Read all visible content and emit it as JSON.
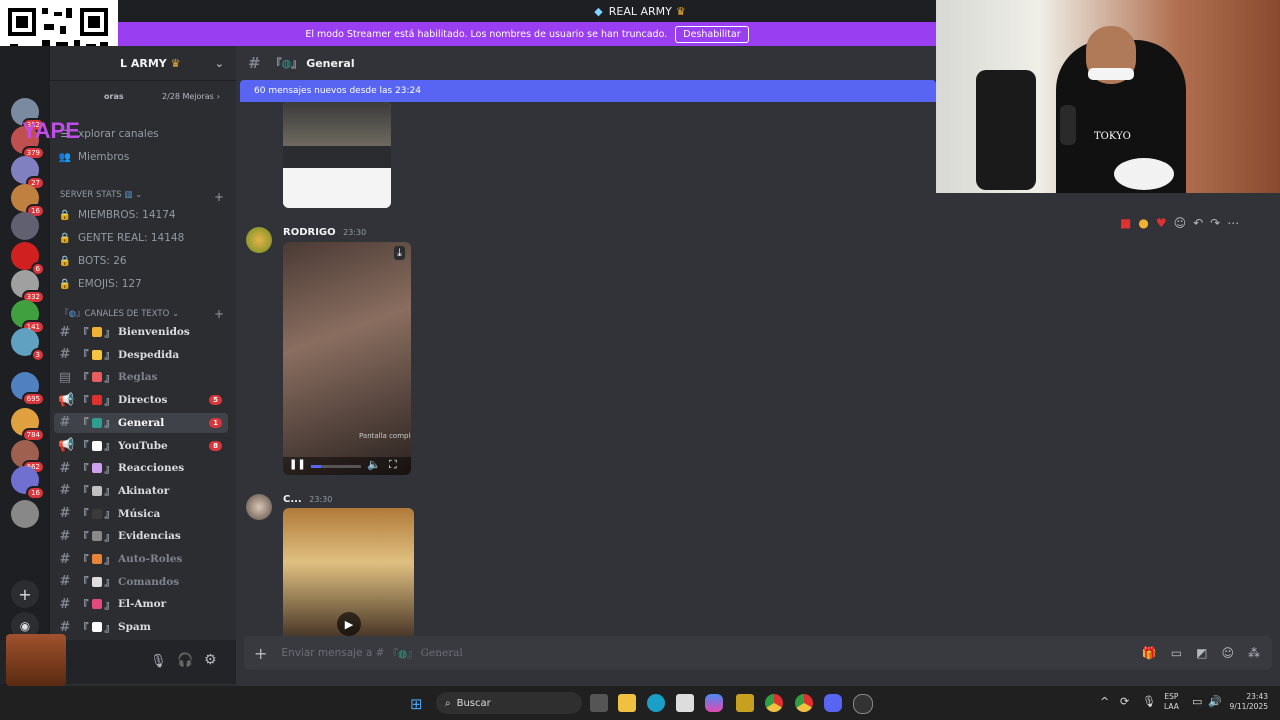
{
  "window": {
    "title": "REAL ARMY"
  },
  "streamer_banner": {
    "message": "El modo Streamer está habilitado. Los nombres de usuario se han truncado.",
    "button": "Deshabilitar"
  },
  "server": {
    "name": "L ARMY",
    "boost_left": "oras",
    "boost_right": "2/28 Mejoras"
  },
  "overlay": {
    "yape": "YAPE",
    "counter": "x692"
  },
  "rail_badges": [
    "382",
    "379",
    "27",
    "16",
    "",
    "6",
    "332",
    "141",
    "3",
    "695",
    "784",
    "662",
    "16",
    ""
  ],
  "sidebar_nav": [
    {
      "label": "xplorar canales"
    },
    {
      "label": "Miembros"
    }
  ],
  "stats_category": "SERVER STATS",
  "stats": [
    "MIEMBROS: 14174",
    "GENTE REAL: 14148",
    "BOTS: 26",
    "EMOJIS: 127"
  ],
  "text_category": "CANALES DE TEXTO",
  "channels": [
    {
      "name": "Bienvenidos",
      "muted": false,
      "badge": "",
      "color": "#f0b232"
    },
    {
      "name": "Despedida",
      "muted": false,
      "badge": "",
      "color": "#f5c542"
    },
    {
      "name": "Reglas",
      "muted": true,
      "badge": "",
      "color": "#e85d5d"
    },
    {
      "name": "Directos",
      "muted": false,
      "badge": "5",
      "color": "#e03131"
    },
    {
      "name": "General",
      "muted": false,
      "badge": "1",
      "color": "#2f9e8f",
      "active": true
    },
    {
      "name": "YouTube",
      "muted": false,
      "badge": "8",
      "color": "#ffffff"
    },
    {
      "name": "Reacciones",
      "muted": false,
      "badge": "",
      "color": "#d0a0f0"
    },
    {
      "name": "Akinator",
      "muted": false,
      "badge": "",
      "color": "#c0c0c0"
    },
    {
      "name": "Música",
      "muted": false,
      "badge": "",
      "color": "#3a3a3a"
    },
    {
      "name": "Evidencias",
      "muted": false,
      "badge": "",
      "color": "#8a8a8a"
    },
    {
      "name": "Auto-Roles",
      "muted": true,
      "badge": "",
      "color": "#e8833a"
    },
    {
      "name": "Comandos",
      "muted": true,
      "badge": "",
      "color": "#dddddd"
    },
    {
      "name": "El-Amor",
      "muted": false,
      "badge": "",
      "color": "#e64980"
    },
    {
      "name": "Spam",
      "muted": false,
      "badge": "",
      "color": "#ffffff"
    }
  ],
  "channel_header": {
    "name": "General"
  },
  "new_messages": "60 mensajes nuevos desde las 23:24",
  "messages": [
    {
      "author": "RODRIGO",
      "time": "23:30",
      "media_hint": "Pantalla completa"
    },
    {
      "author": "C...",
      "time": "23:30"
    }
  ],
  "composer": {
    "placeholder_prefix": "Enviar mensaje a #",
    "placeholder_channel": "General"
  },
  "taskbar": {
    "search": "Buscar",
    "lang_top": "ESP",
    "lang_bottom": "LAA",
    "time": "23:43",
    "date": "9/11/2025"
  },
  "webcam": {
    "shirt_text": "TOKYO"
  },
  "colors": {
    "accent": "#5865f2",
    "streamer": "#9a3ef2",
    "badge": "#da373c"
  }
}
